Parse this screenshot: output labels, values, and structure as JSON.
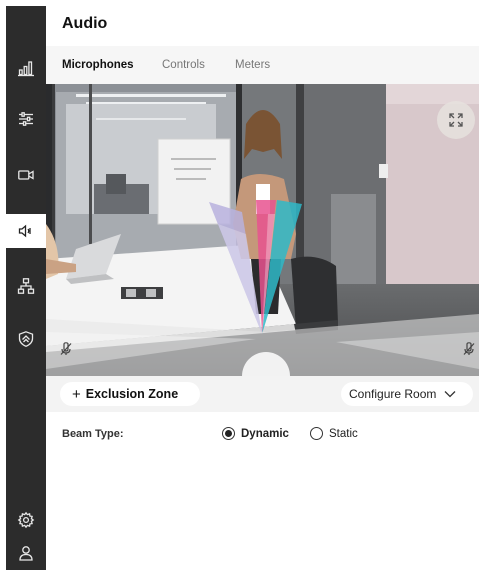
{
  "app": {
    "title": "Audio"
  },
  "sidebar": {
    "items": [
      {
        "name": "statistics",
        "icon": "bar-chart-icon",
        "active": false
      },
      {
        "name": "settings-adjust",
        "icon": "sliders-icon",
        "active": false
      },
      {
        "name": "camera",
        "icon": "video-camera-icon",
        "active": false
      },
      {
        "name": "audio",
        "icon": "speaker-icon",
        "active": true
      },
      {
        "name": "network",
        "icon": "network-icon",
        "active": false
      },
      {
        "name": "security",
        "icon": "shield-icon",
        "active": false
      }
    ],
    "bottom": [
      {
        "name": "settings",
        "icon": "gear-icon"
      },
      {
        "name": "user",
        "icon": "user-icon"
      }
    ]
  },
  "tabs": [
    {
      "label": "Microphones",
      "active": true
    },
    {
      "label": "Controls",
      "active": false
    },
    {
      "label": "Meters",
      "active": false
    }
  ],
  "camera_view": {
    "fullscreen_icon": "expand-icon",
    "left_mute_icon": "mic-muted-icon",
    "right_mute_icon": "mic-muted-icon",
    "beam_colors": [
      "#b8b2de",
      "#e7528f",
      "#2fb8c8"
    ]
  },
  "toolbar": {
    "exclusion_plus": "+",
    "exclusion_label": "Exclusion Zone",
    "configure_label": "Configure Room",
    "configure_icon": "chevron-down-icon"
  },
  "beam_type": {
    "label": "Beam Type:",
    "options": [
      {
        "label": "Dynamic",
        "selected": true
      },
      {
        "label": "Static",
        "selected": false
      }
    ]
  },
  "colors": {
    "sidebar_bg": "#2c2c2c",
    "tabs_bg": "#f6f6f6",
    "toolbar_bg": "#f3f3f3"
  }
}
